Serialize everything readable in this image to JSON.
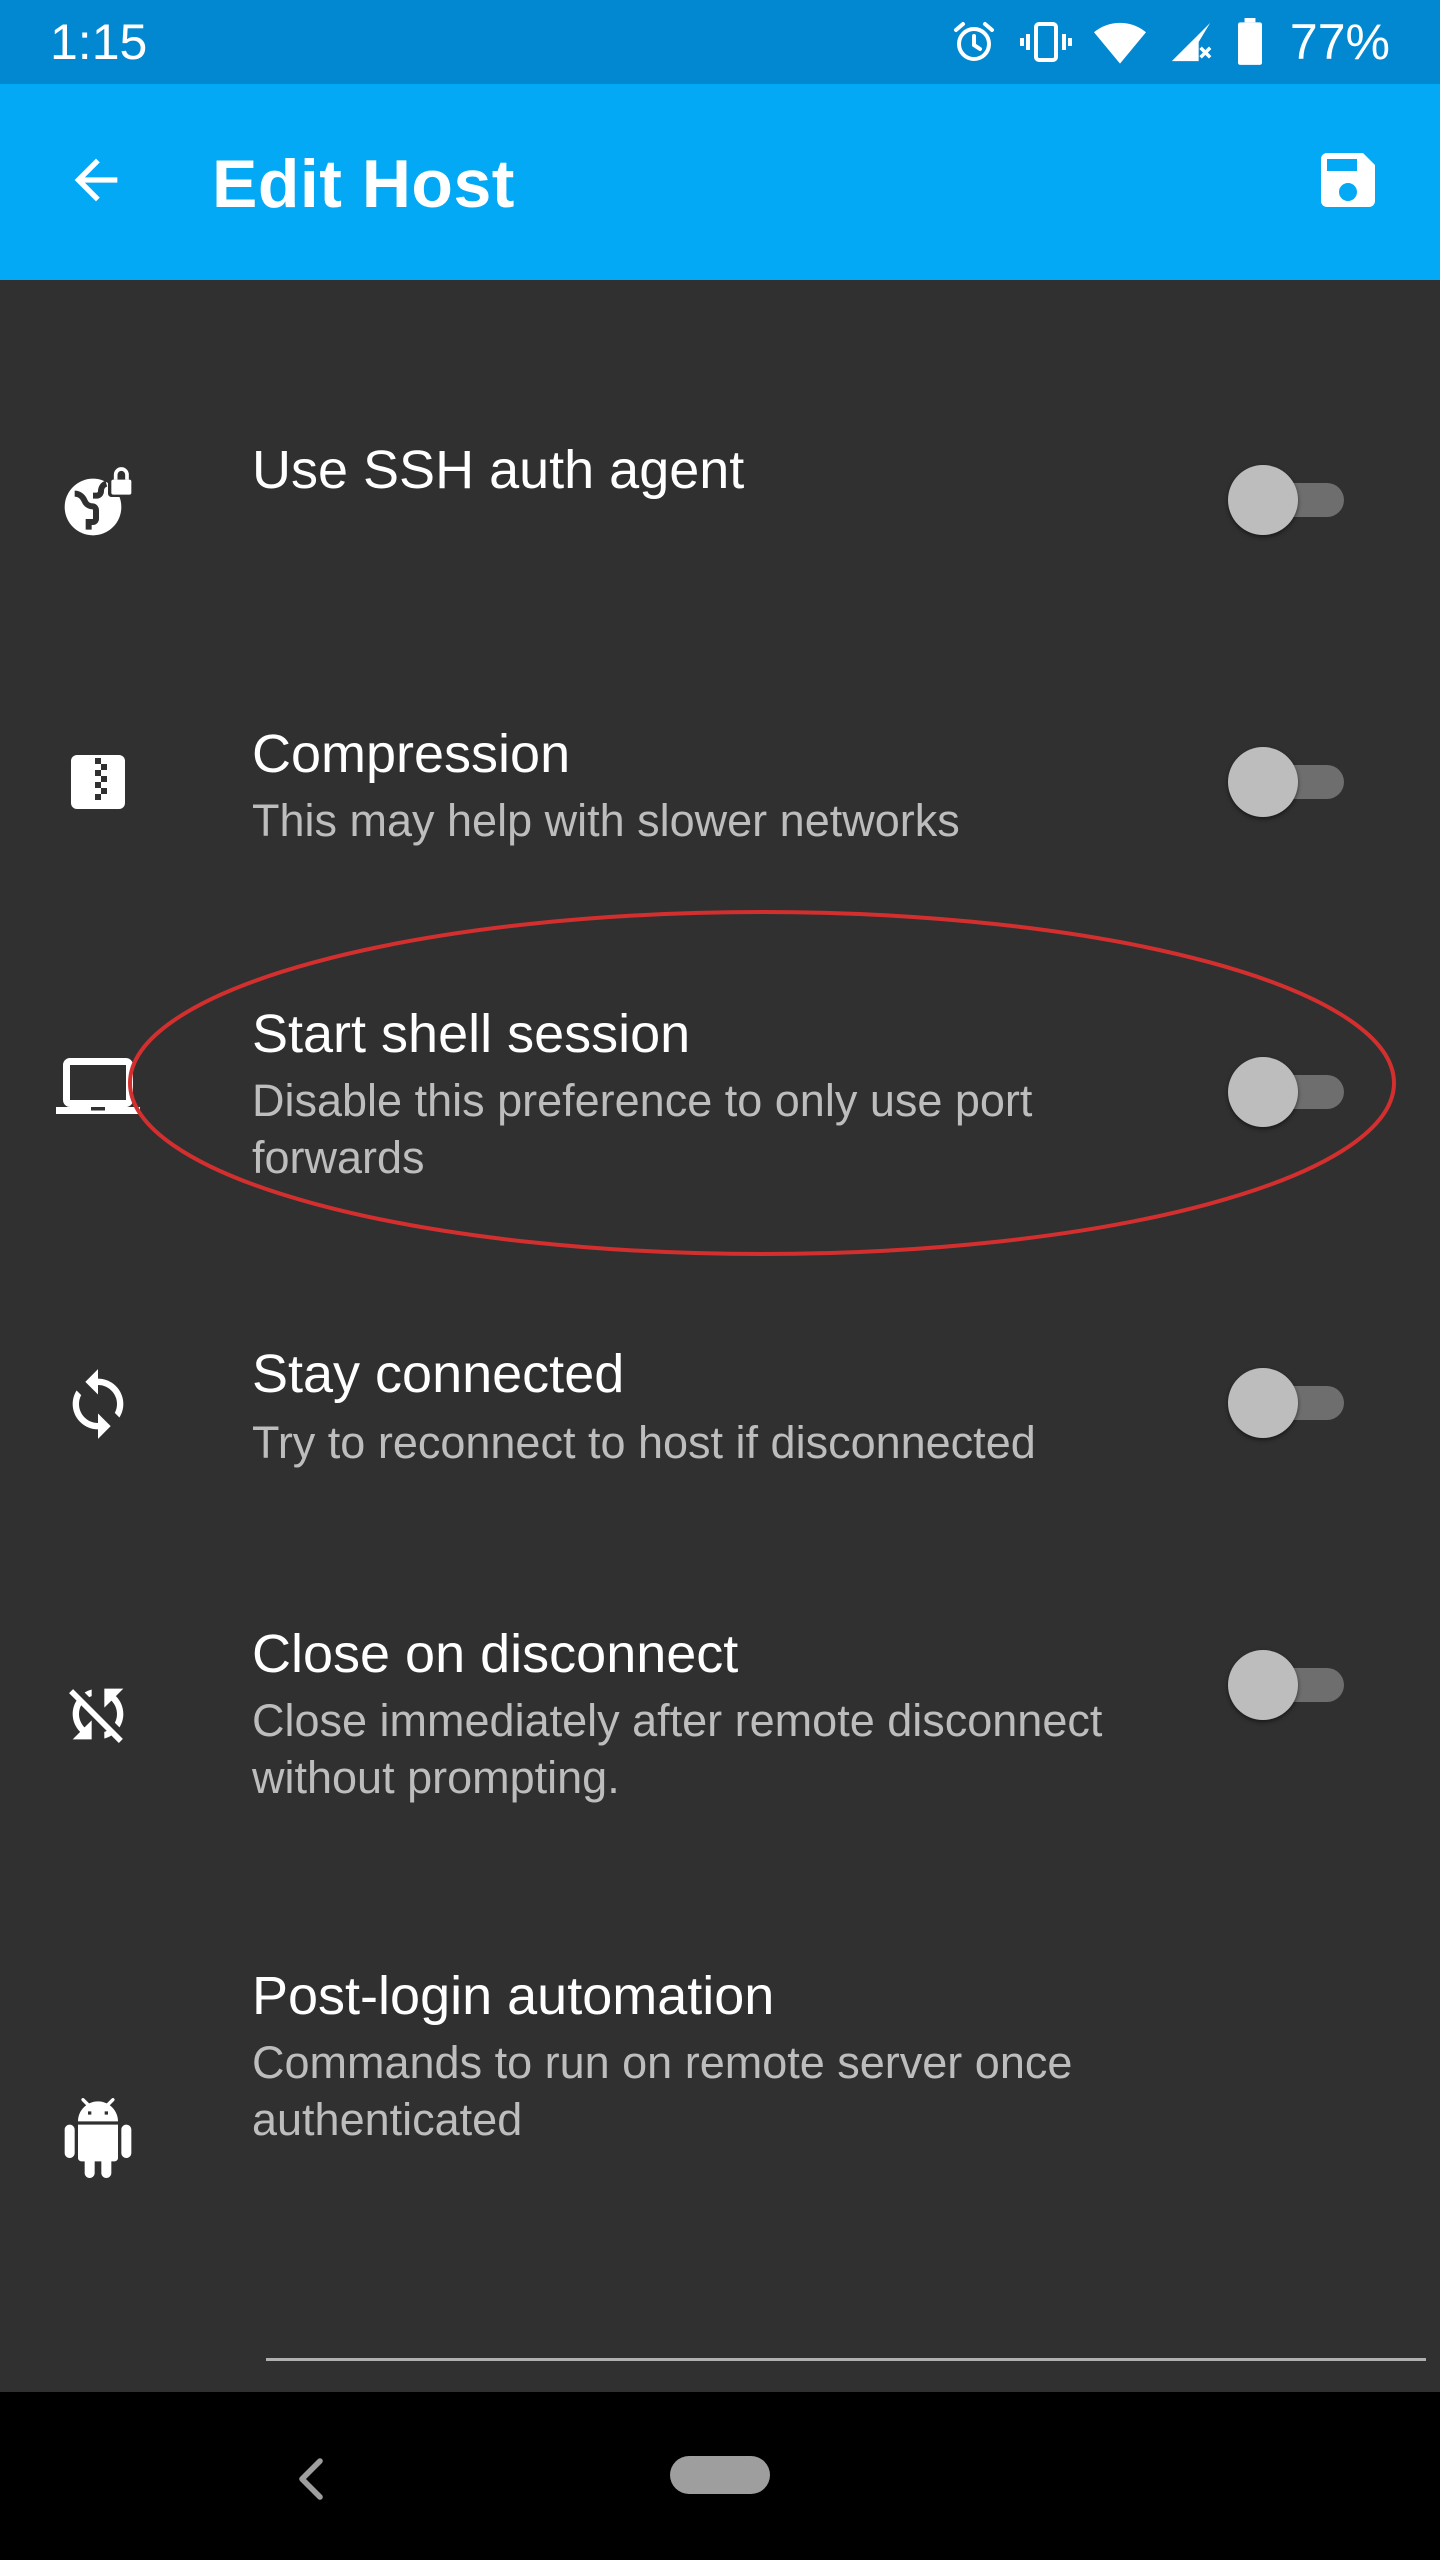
{
  "status_bar": {
    "time": "1:15",
    "battery_percent": "77%",
    "icons": [
      "alarm-icon",
      "vibrate-icon",
      "wifi-icon",
      "signal-icon",
      "battery-icon"
    ]
  },
  "app_bar": {
    "title": "Edit Host",
    "back_icon": "arrow-back-icon",
    "save_icon": "save-icon",
    "background_color": "#03a9f4",
    "status_color": "#0288d1"
  },
  "preferences": [
    {
      "title": "Use SSH auth agent",
      "summary": "",
      "icon": "globe-lock-icon",
      "toggle_on": false
    },
    {
      "title": "Compression",
      "summary": "This may help with slower networks",
      "icon": "archive-icon",
      "toggle_on": false
    },
    {
      "title": "Start shell session",
      "summary": "Disable this preference to only use port forwards",
      "icon": "laptop-icon",
      "toggle_on": false,
      "highlighted": true
    },
    {
      "title": "Stay connected",
      "summary": "Try to reconnect to host if disconnected",
      "icon": "sync-icon",
      "toggle_on": false
    },
    {
      "title": "Close on disconnect",
      "summary": "Close immediately after remote disconnect without prompting.",
      "icon": "sync-disabled-icon",
      "toggle_on": false
    },
    {
      "title": "Post-login automation",
      "summary": "Commands to run on remote server once authenticated",
      "icon": "android-icon"
    }
  ],
  "annotation": {
    "shape": "ellipse",
    "color": "#d32f2f",
    "target": "Start shell session"
  },
  "nav_bar": {
    "back_icon": "nav-back-icon",
    "home_icon": "nav-home-pill-icon"
  }
}
